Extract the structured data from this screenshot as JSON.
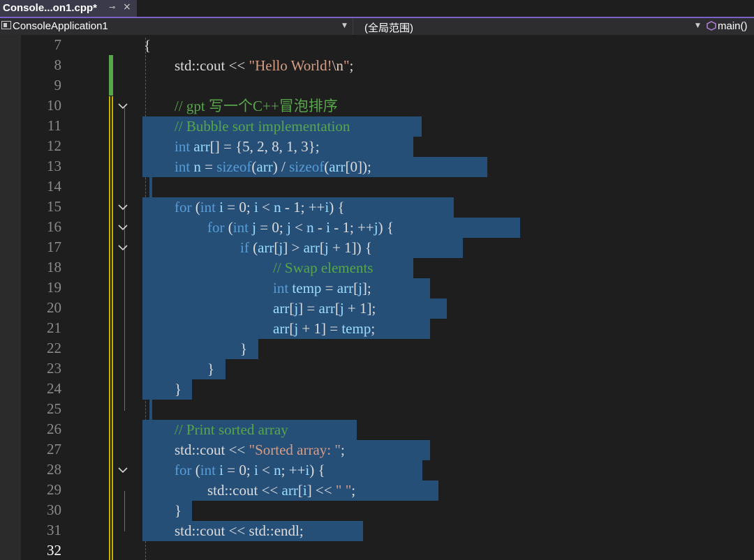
{
  "tab": {
    "title": "Console...on1.cpp*",
    "pin_icon": "⊸",
    "close_icon": "×"
  },
  "navbar": {
    "project": "ConsoleApplication1",
    "scope": "(全局范围)",
    "member": "main()"
  },
  "colors": {
    "selection": "#264f78",
    "keyword": "#569cd6",
    "comment": "#57a64a",
    "string": "#d69d85",
    "identifier": "#9cdcfe",
    "changed_saved": "#57a64a",
    "changed_unsaved": "#c8b400"
  },
  "lines": [
    {
      "num": "7",
      "selected": false,
      "fold": false,
      "tokens": [
        [
          "pl",
          "{"
        ]
      ]
    },
    {
      "num": "8",
      "selected": false,
      "fold": false,
      "tokens": [
        [
          "pl",
          "std::cout << "
        ],
        [
          "str",
          "\"Hello World!"
        ],
        [
          "esc",
          "\\n"
        ],
        [
          "str",
          "\""
        ],
        [
          "pl",
          ";"
        ]
      ]
    },
    {
      "num": "9",
      "selected": false,
      "fold": false,
      "tokens": []
    },
    {
      "num": "10",
      "selected": false,
      "fold": true,
      "tokens": [
        [
          "cm",
          "// gpt 写一个C++冒泡排序"
        ]
      ]
    },
    {
      "num": "11",
      "selected": true,
      "fold": false,
      "tokens": [
        [
          "cm",
          "// Bubble sort implementation"
        ]
      ]
    },
    {
      "num": "12",
      "selected": true,
      "fold": false,
      "tokens": [
        [
          "kw",
          "int"
        ],
        [
          "pl",
          " "
        ],
        [
          "id",
          "arr"
        ],
        [
          "pl",
          "[] = {5, 2, 8, 1, 3};"
        ]
      ]
    },
    {
      "num": "13",
      "selected": true,
      "fold": false,
      "tokens": [
        [
          "kw",
          "int"
        ],
        [
          "pl",
          " "
        ],
        [
          "id",
          "n"
        ],
        [
          "pl",
          " = "
        ],
        [
          "kw",
          "sizeof"
        ],
        [
          "pl",
          "("
        ],
        [
          "id",
          "arr"
        ],
        [
          "pl",
          ") / "
        ],
        [
          "kw",
          "sizeof"
        ],
        [
          "pl",
          "("
        ],
        [
          "id",
          "arr"
        ],
        [
          "pl",
          "[0]);"
        ]
      ]
    },
    {
      "num": "14",
      "selected": true,
      "fold": false,
      "tokens": []
    },
    {
      "num": "15",
      "selected": true,
      "fold": true,
      "tokens": [
        [
          "kw",
          "for"
        ],
        [
          "pl",
          " ("
        ],
        [
          "kw",
          "int"
        ],
        [
          "pl",
          " "
        ],
        [
          "id",
          "i"
        ],
        [
          "pl",
          " = 0; "
        ],
        [
          "id",
          "i"
        ],
        [
          "pl",
          " < "
        ],
        [
          "id",
          "n"
        ],
        [
          "pl",
          " - 1; ++"
        ],
        [
          "id",
          "i"
        ],
        [
          "pl",
          ") {"
        ]
      ]
    },
    {
      "num": "16",
      "selected": true,
      "fold": true,
      "tokens": [
        [
          "kw",
          "for"
        ],
        [
          "pl",
          " ("
        ],
        [
          "kw",
          "int"
        ],
        [
          "pl",
          " "
        ],
        [
          "id",
          "j"
        ],
        [
          "pl",
          " = 0; "
        ],
        [
          "id",
          "j"
        ],
        [
          "pl",
          " < "
        ],
        [
          "id",
          "n"
        ],
        [
          "pl",
          " - "
        ],
        [
          "id",
          "i"
        ],
        [
          "pl",
          " - 1; ++"
        ],
        [
          "id",
          "j"
        ],
        [
          "pl",
          ") {"
        ]
      ]
    },
    {
      "num": "17",
      "selected": true,
      "fold": true,
      "tokens": [
        [
          "kw",
          "if"
        ],
        [
          "pl",
          " ("
        ],
        [
          "id",
          "arr"
        ],
        [
          "pl",
          "["
        ],
        [
          "id",
          "j"
        ],
        [
          "pl",
          "] > "
        ],
        [
          "id",
          "arr"
        ],
        [
          "pl",
          "["
        ],
        [
          "id",
          "j"
        ],
        [
          "pl",
          " + 1]) {"
        ]
      ]
    },
    {
      "num": "18",
      "selected": true,
      "fold": false,
      "tokens": [
        [
          "cm",
          "// Swap elements"
        ]
      ]
    },
    {
      "num": "19",
      "selected": true,
      "fold": false,
      "tokens": [
        [
          "kw",
          "int"
        ],
        [
          "pl",
          " "
        ],
        [
          "id",
          "temp"
        ],
        [
          "pl",
          " = "
        ],
        [
          "id",
          "arr"
        ],
        [
          "pl",
          "["
        ],
        [
          "id",
          "j"
        ],
        [
          "pl",
          "];"
        ]
      ]
    },
    {
      "num": "20",
      "selected": true,
      "fold": false,
      "tokens": [
        [
          "id",
          "arr"
        ],
        [
          "pl",
          "["
        ],
        [
          "id",
          "j"
        ],
        [
          "pl",
          "] = "
        ],
        [
          "id",
          "arr"
        ],
        [
          "pl",
          "["
        ],
        [
          "id",
          "j"
        ],
        [
          "pl",
          " + 1];"
        ]
      ]
    },
    {
      "num": "21",
      "selected": true,
      "fold": false,
      "tokens": [
        [
          "id",
          "arr"
        ],
        [
          "pl",
          "["
        ],
        [
          "id",
          "j"
        ],
        [
          "pl",
          " + 1] = "
        ],
        [
          "id",
          "temp"
        ],
        [
          "pl",
          ";"
        ]
      ]
    },
    {
      "num": "22",
      "selected": true,
      "fold": false,
      "tokens": [
        [
          "pl",
          "}"
        ]
      ]
    },
    {
      "num": "23",
      "selected": true,
      "fold": false,
      "tokens": [
        [
          "pl",
          "}"
        ]
      ]
    },
    {
      "num": "24",
      "selected": true,
      "fold": false,
      "tokens": [
        [
          "pl",
          "}"
        ]
      ]
    },
    {
      "num": "25",
      "selected": true,
      "fold": false,
      "tokens": []
    },
    {
      "num": "26",
      "selected": true,
      "fold": false,
      "tokens": [
        [
          "cm",
          "// Print sorted array"
        ]
      ]
    },
    {
      "num": "27",
      "selected": true,
      "fold": false,
      "tokens": [
        [
          "pl",
          "std::cout << "
        ],
        [
          "str",
          "\"Sorted array: \""
        ],
        [
          "pl",
          ";"
        ]
      ]
    },
    {
      "num": "28",
      "selected": true,
      "fold": true,
      "tokens": [
        [
          "kw",
          "for"
        ],
        [
          "pl",
          " ("
        ],
        [
          "kw",
          "int"
        ],
        [
          "pl",
          " "
        ],
        [
          "id",
          "i"
        ],
        [
          "pl",
          " = 0; "
        ],
        [
          "id",
          "i"
        ],
        [
          "pl",
          " < "
        ],
        [
          "id",
          "n"
        ],
        [
          "pl",
          "; ++"
        ],
        [
          "id",
          "i"
        ],
        [
          "pl",
          ") {"
        ]
      ]
    },
    {
      "num": "29",
      "selected": true,
      "fold": false,
      "tokens": [
        [
          "pl",
          "std::cout << "
        ],
        [
          "id",
          "arr"
        ],
        [
          "pl",
          "["
        ],
        [
          "id",
          "i"
        ],
        [
          "pl",
          "] << "
        ],
        [
          "str",
          "\" \""
        ],
        [
          "pl",
          ";"
        ]
      ]
    },
    {
      "num": "30",
      "selected": true,
      "fold": false,
      "tokens": [
        [
          "pl",
          "}"
        ]
      ]
    },
    {
      "num": "31",
      "selected": true,
      "fold": false,
      "tokens": [
        [
          "pl",
          "std::cout << std::endl;"
        ]
      ]
    },
    {
      "num": "32",
      "selected": false,
      "fold": false,
      "active": true,
      "tokens": []
    }
  ]
}
